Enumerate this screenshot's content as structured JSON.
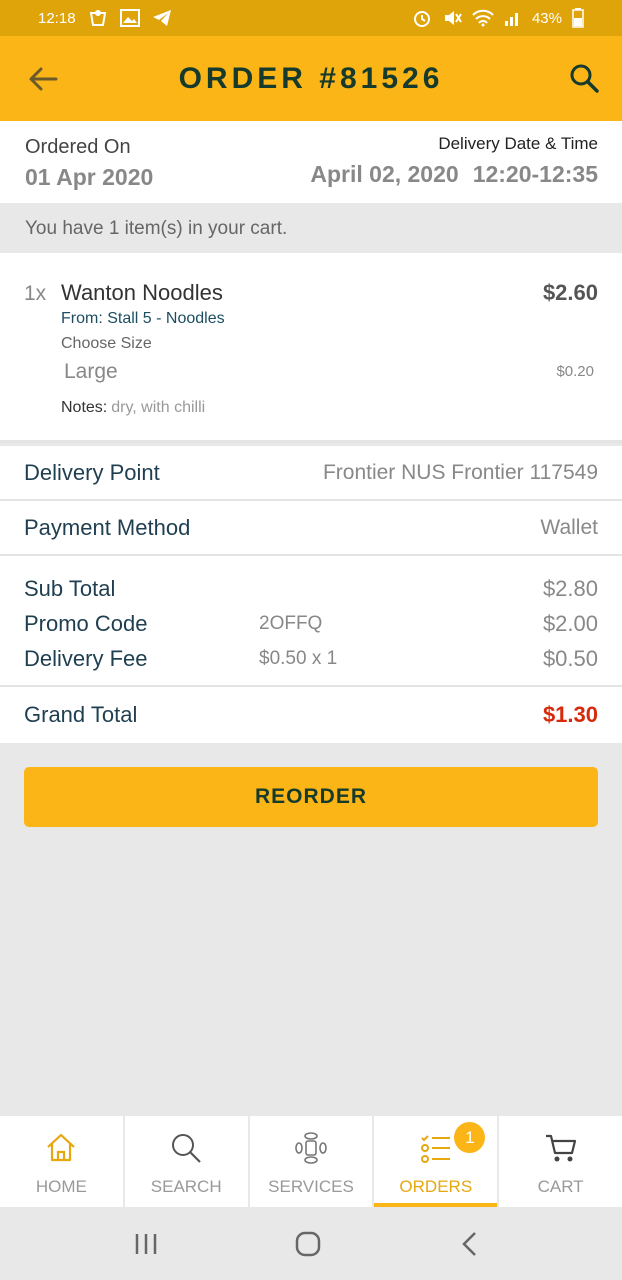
{
  "status_bar": {
    "time": "12:18",
    "battery": "43%"
  },
  "header": {
    "title": "ORDER #81526"
  },
  "order": {
    "ordered_on_label": "Ordered On",
    "ordered_on_date": "01 Apr 2020",
    "delivery_label": "Delivery Date & Time",
    "delivery_date": "April 02, 2020",
    "delivery_time": "12:20-12:35"
  },
  "cart_message": "You have 1 item(s) in your cart.",
  "item": {
    "qty": "1x",
    "name": "Wanton Noodles",
    "price": "$2.60",
    "stall": "From: Stall 5 - Noodles",
    "option_label": "Choose Size",
    "option_value": "Large",
    "option_price": "$0.20",
    "notes_label": "Notes:",
    "notes_value": "dry, with chilli"
  },
  "delivery_point": {
    "label": "Delivery Point",
    "value": "Frontier NUS Frontier 117549"
  },
  "payment_method": {
    "label": "Payment Method",
    "value": "Wallet"
  },
  "totals": {
    "subtotal_label": "Sub Total",
    "subtotal_value": "$2.80",
    "promo_label": "Promo Code",
    "promo_code": "2OFFQ",
    "promo_value": "$2.00",
    "delivery_fee_label": "Delivery Fee",
    "delivery_fee_detail": "$0.50 x 1",
    "delivery_fee_value": "$0.50",
    "grand_label": "Grand Total",
    "grand_value": "$1.30"
  },
  "reorder_label": "REORDER",
  "nav": {
    "home": "HOME",
    "search": "SEARCH",
    "services": "SERVICES",
    "orders": "ORDERS",
    "orders_badge": "1",
    "cart": "CART"
  },
  "colors": {
    "brand": "#fbb516",
    "status_bar": "#e0a40b",
    "dark_text": "#163a2c",
    "grand_total": "#d72a0b"
  }
}
